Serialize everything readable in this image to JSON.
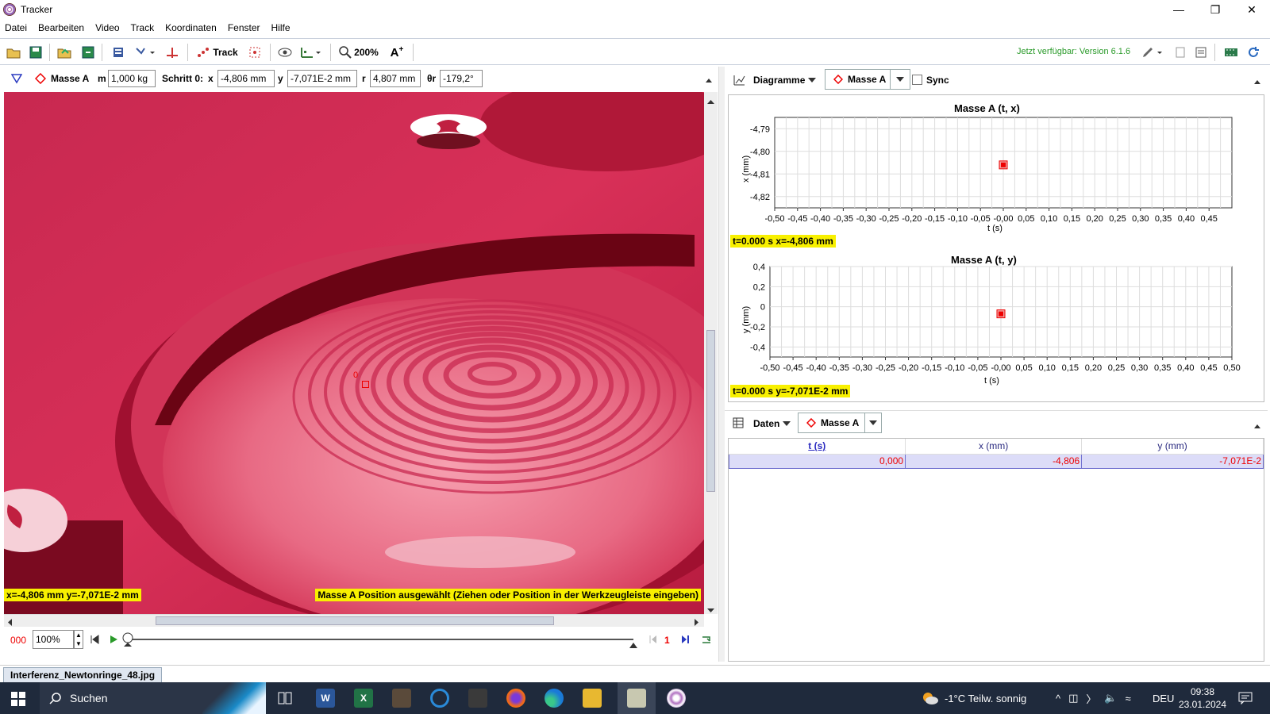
{
  "window": {
    "title": "Tracker"
  },
  "menu": [
    "Datei",
    "Bearbeiten",
    "Video",
    "Track",
    "Koordinaten",
    "Fenster",
    "Hilfe"
  ],
  "toolbar": {
    "track_label": "Track",
    "zoom_label": "200%",
    "update_notice": "Jetzt verfügbar: Version 6.1.6"
  },
  "trackbar": {
    "track_name": "Masse A",
    "mass_label": "m",
    "mass_value": "1,000 kg",
    "step_label": "Schritt 0:",
    "x_label": "x",
    "x_value": "-4,806 mm",
    "y_label": "y",
    "y_value": "-7,071E-2 mm",
    "r_label": "r",
    "r_value": "4,807 mm",
    "theta_label": "θr",
    "theta_value": "-179,2°"
  },
  "video": {
    "point_label": "0",
    "coords_status": "x=-4,806 mm  y=-7,071E-2 mm",
    "hint_status": "Masse A Position ausgewählt (Ziehen oder Position in der Werkzeugleiste eingeben)"
  },
  "playback": {
    "frame": "000",
    "rate": "100%",
    "step": "1"
  },
  "plots_header": {
    "view_label": "Diagramme",
    "track_label": "Masse A",
    "sync_label": "Sync"
  },
  "plot1": {
    "title": "Masse A (t, x)",
    "ylabel": "x (mm)",
    "xlabel": "t (s)",
    "yticks": [
      "-4,79",
      "-4,80",
      "-4,81",
      "-4,82"
    ],
    "xticks": [
      "-0,50",
      "-0,45",
      "-0,40",
      "-0,35",
      "-0,30",
      "-0,25",
      "-0,20",
      "-0,15",
      "-0,10",
      "-0,05",
      "-0,00",
      "0,05",
      "0,10",
      "0,15",
      "0,20",
      "0,25",
      "0,30",
      "0,35",
      "0,40",
      "0,45"
    ],
    "status": "t=0.000 s  x=-4,806 mm"
  },
  "plot2": {
    "title": "Masse A (t, y)",
    "ylabel": "y (mm)",
    "xlabel": "t (s)",
    "yticks": [
      "0,4",
      "0,2",
      "0",
      "-0,2",
      "-0,4"
    ],
    "xticks": [
      "-0,50",
      "-0,45",
      "-0,40",
      "-0,35",
      "-0,30",
      "-0,25",
      "-0,20",
      "-0,15",
      "-0,10",
      "-0,05",
      "-0,00",
      "0,05",
      "0,10",
      "0,15",
      "0,20",
      "0,25",
      "0,30",
      "0,35",
      "0,40",
      "0,45",
      "0,50"
    ],
    "status": "t=0.000 s  y=-7,071E-2 mm"
  },
  "chart_data": [
    {
      "type": "scatter",
      "title": "Masse A (t, x)",
      "xlabel": "t (s)",
      "ylabel": "x (mm)",
      "xlim": [
        -0.5,
        0.5
      ],
      "ylim": [
        -4.825,
        -4.785
      ],
      "points": [
        {
          "x": 0.0,
          "y": -4.806
        }
      ]
    },
    {
      "type": "scatter",
      "title": "Masse A (t, y)",
      "xlabel": "t (s)",
      "ylabel": "y (mm)",
      "xlim": [
        -0.5,
        0.5
      ],
      "ylim": [
        -0.5,
        0.4
      ],
      "points": [
        {
          "x": 0.0,
          "y": -0.07071
        }
      ]
    }
  ],
  "table_header": {
    "view_label": "Daten",
    "track_label": "Masse A"
  },
  "table": {
    "columns": [
      "t (s)",
      "x (mm)",
      "y (mm)"
    ],
    "rows": [
      [
        "0,000",
        "-4,806",
        "-7,071E-2"
      ]
    ]
  },
  "file_tab": "Interferenz_Newtonringe_48.jpg",
  "taskbar": {
    "search_label": "Suchen",
    "weather": "-1°C  Teilw. sonnig",
    "lang": "DEU",
    "time": "09:38",
    "date": "23.01.2024"
  },
  "colors": {
    "accent": "#e00000",
    "highlight": "#f8f000",
    "update": "#2a9a2a"
  }
}
